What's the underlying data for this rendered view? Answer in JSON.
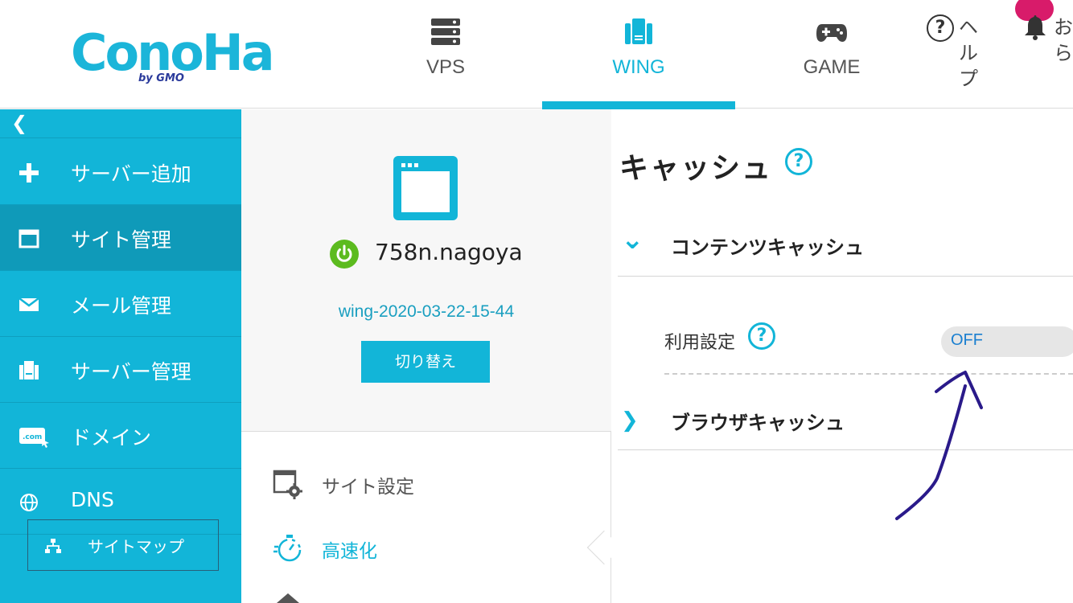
{
  "header": {
    "logo_text": "ConoHa",
    "logo_sub": "by GMO",
    "tabs": [
      {
        "label": "VPS",
        "icon": "server-icon"
      },
      {
        "label": "WING",
        "icon": "wing-icon",
        "active": true
      },
      {
        "label": "GAME",
        "icon": "gamepad-icon"
      }
    ],
    "help_label": "ヘルプ",
    "help_icon": "?",
    "notice_label": "おら"
  },
  "sidebar": {
    "collapse_icon": "❮",
    "items": [
      {
        "label": "サーバー追加",
        "icon": "plus-icon"
      },
      {
        "label": "サイト管理",
        "icon": "window-icon",
        "active": true
      },
      {
        "label": "メール管理",
        "icon": "mail-icon"
      },
      {
        "label": "サーバー管理",
        "icon": "server-manage-icon"
      },
      {
        "label": "ドメイン",
        "icon": "domain-icon"
      },
      {
        "label": "DNS",
        "icon": "globe-icon"
      }
    ],
    "sitemap_label": "サイトマップ"
  },
  "site": {
    "name": "758n.nagoya",
    "id": "wing-2020-03-22-15-44",
    "switch_label": "切り替え"
  },
  "site_menu": [
    {
      "label": "サイト設定",
      "icon": "site-settings-icon"
    },
    {
      "label": "高速化",
      "icon": "stopwatch-icon",
      "active": true
    }
  ],
  "cache": {
    "title": "キャッシュ",
    "help": "?",
    "content_cache_label": "コンテンツキャッシュ",
    "setting_label": "利用設定",
    "toggle_value": "OFF",
    "browser_cache_label": "ブラウザキャッシュ",
    "expanded_chevron": "⌄",
    "collapsed_chevron": "❯"
  },
  "colors": {
    "accent": "#12b5d8",
    "sidebar_active": "#0f9ab9",
    "power": "#5cbb1f",
    "badge": "#d81b6a",
    "annotation": "#2a1a8a"
  }
}
